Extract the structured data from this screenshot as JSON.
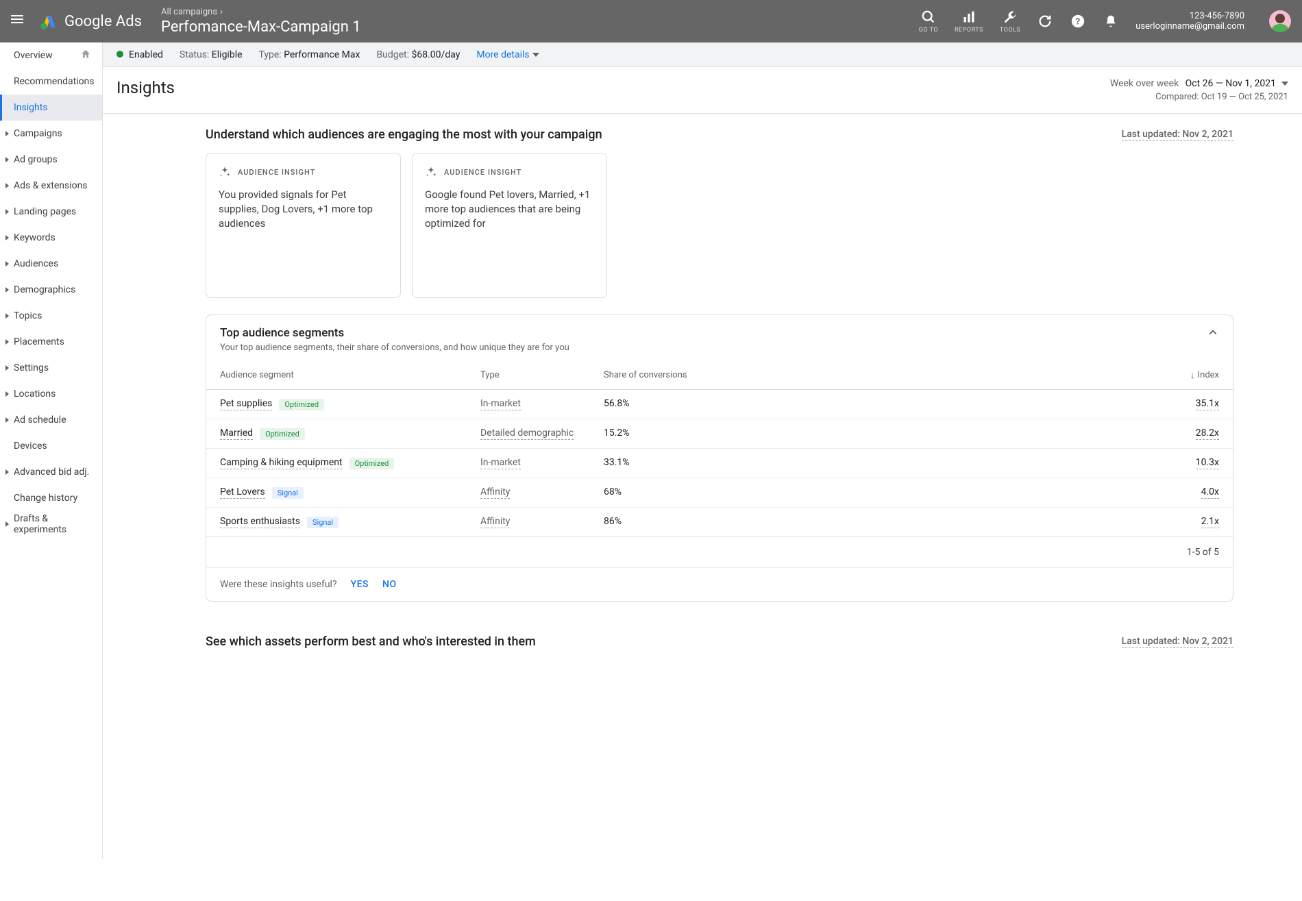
{
  "header": {
    "logo_text": "Google Ads",
    "breadcrumb_top": "All campaigns",
    "breadcrumb_title": "Perfomance-Max-Campaign 1",
    "tools": {
      "goto": "GO TO",
      "reports": "REPORTS",
      "tools": "TOOLS"
    },
    "user": {
      "phone": "123-456-7890",
      "email": "userloginname@gmail.com"
    }
  },
  "status_bar": {
    "enabled": "Enabled",
    "status_label": "Status:",
    "status_value": "Eligible",
    "type_label": "Type:",
    "type_value": "Performance Max",
    "budget_label": "Budget:",
    "budget_value": "$68.00/day",
    "more_details": "More details"
  },
  "sidebar": {
    "items": [
      {
        "label": "Overview",
        "home": true
      },
      {
        "label": "Recommendations"
      },
      {
        "label": "Insights",
        "active": true
      },
      {
        "label": "Campaigns",
        "arrow": true
      },
      {
        "label": "Ad groups",
        "arrow": true
      },
      {
        "label": "Ads & extensions",
        "arrow": true
      },
      {
        "label": "Landing pages",
        "arrow": true
      },
      {
        "label": "Keywords",
        "arrow": true
      },
      {
        "label": "Audiences",
        "arrow": true
      },
      {
        "label": "Demographics",
        "arrow": true
      },
      {
        "label": "Topics",
        "arrow": true
      },
      {
        "label": "Placements",
        "arrow": true
      },
      {
        "label": "Settings",
        "arrow": true
      },
      {
        "label": "Locations",
        "arrow": true
      },
      {
        "label": "Ad schedule",
        "arrow": true
      },
      {
        "label": "Devices"
      },
      {
        "label": "Advanced bid adj.",
        "arrow": true
      },
      {
        "label": "Change history"
      },
      {
        "label": "Drafts & experiments",
        "arrow": true
      }
    ]
  },
  "page": {
    "title": "Insights",
    "wow_label": "Week over week",
    "date_range": "Oct 26 — Nov 1, 2021",
    "compared": "Compared: Oct 19 — Oct 25, 2021"
  },
  "section1": {
    "title": "Understand which audiences are engaging the most with your campaign",
    "last_updated": "Last updated: Nov 2, 2021",
    "card_label": "AUDIENCE INSIGHT",
    "cards": [
      {
        "text": "You provided signals for Pet supplies, Dog Lovers, +1 more top audiences"
      },
      {
        "text": "Google found Pet lovers, Married, +1 more top audiences that are being optimized for"
      }
    ]
  },
  "segments": {
    "title": "Top audience segments",
    "subtitle": "Your top audience segments, their share of conversions, and how unique they are for you",
    "columns": {
      "seg": "Audience segment",
      "type": "Type",
      "share": "Share of conversions",
      "index": "Index"
    },
    "rows": [
      {
        "name": "Pet supplies",
        "badge": "Optimized",
        "badge_class": "optimized",
        "type": "In-market",
        "share": "56.8%",
        "index": "35.1x"
      },
      {
        "name": "Married",
        "badge": "Optimized",
        "badge_class": "optimized",
        "type": "Detailed demographic",
        "share": "15.2%",
        "index": "28.2x"
      },
      {
        "name": "Camping & hiking equipment",
        "badge": "Optimized",
        "badge_class": "optimized",
        "type": "In-market",
        "share": "33.1%",
        "index": "10.3x"
      },
      {
        "name": "Pet Lovers",
        "badge": "Signal",
        "badge_class": "signal",
        "type": "Affinity",
        "share": "68%",
        "index": "4.0x"
      },
      {
        "name": "Sports enthusiasts",
        "badge": "Signal",
        "badge_class": "signal",
        "type": "Affinity",
        "share": "86%",
        "index": "2.1x"
      }
    ],
    "pagination": "1-5 of 5",
    "feedback_q": "Were these insights useful?",
    "yes": "YES",
    "no": "NO"
  },
  "section2": {
    "title": "See which assets perform best and who's interested in them",
    "last_updated": "Last updated: Nov 2, 2021"
  }
}
